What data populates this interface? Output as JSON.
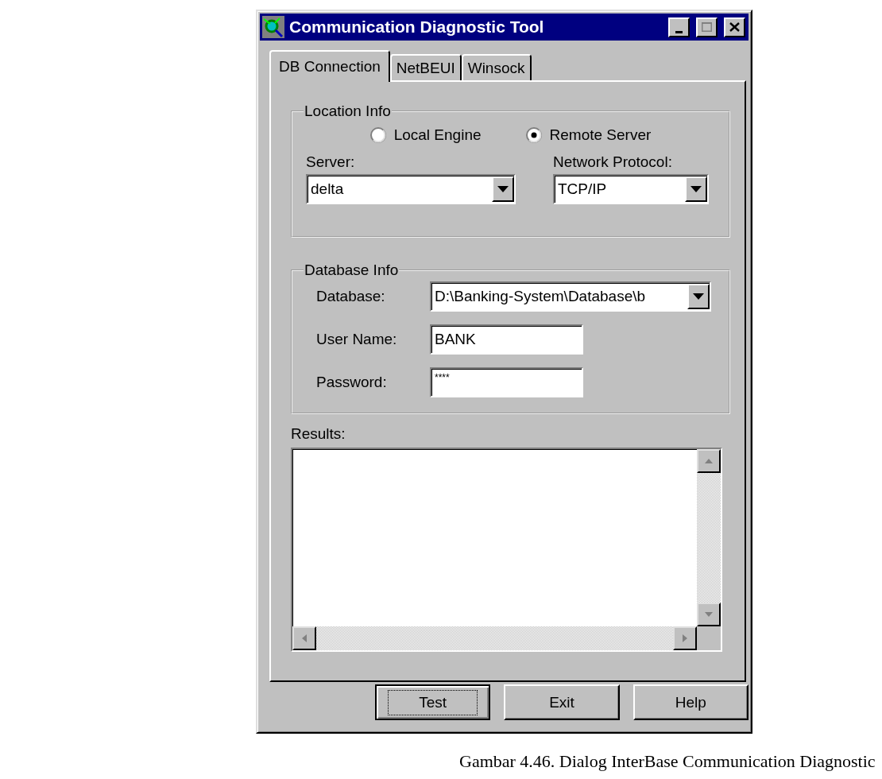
{
  "window": {
    "title": "Communication Diagnostic Tool"
  },
  "tabs": [
    {
      "label": "DB Connection",
      "selected": true
    },
    {
      "label": "NetBEUI",
      "selected": false
    },
    {
      "label": "Winsock",
      "selected": false
    }
  ],
  "location_info": {
    "legend": "Location Info",
    "options": [
      {
        "label": "Local Engine",
        "selected": false
      },
      {
        "label": "Remote Server",
        "selected": true
      }
    ],
    "server": {
      "label": "Server:",
      "value": "delta"
    },
    "network_protocol": {
      "label": "Network Protocol:",
      "value": "TCP/IP"
    }
  },
  "database_info": {
    "legend": "Database Info",
    "fields": [
      {
        "kind": "dropdown",
        "label": "Database:",
        "value": "D:\\Banking-System\\Database\\b"
      },
      {
        "kind": "text",
        "label": "User Name:",
        "value": "BANK"
      },
      {
        "kind": "password",
        "label": "Password:",
        "value": "****"
      }
    ]
  },
  "results": {
    "label": "Results:"
  },
  "buttons": [
    {
      "label": "Test",
      "focused": true
    },
    {
      "label": "Exit",
      "focused": false
    },
    {
      "label": "Help",
      "focused": false
    }
  ],
  "caption": "Gambar 4.46. Dialog InterBase Communication Diagnostic"
}
